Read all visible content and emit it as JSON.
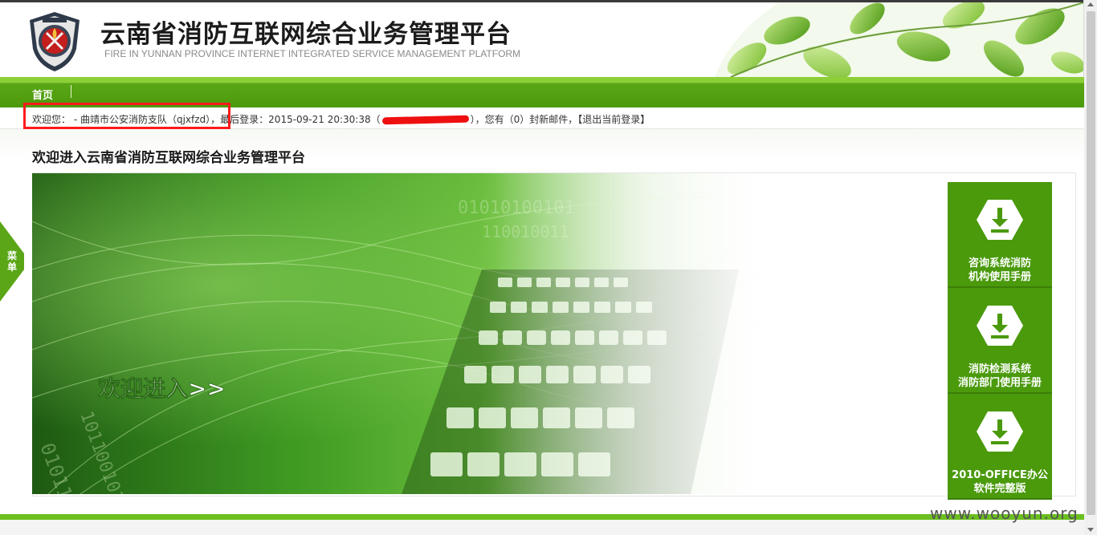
{
  "header": {
    "title_cn": "云南省消防互联网综合业务管理平台",
    "title_en": "FIRE IN YUNNAN PROVINCE INTERNET INTEGRATED SERVICE MANAGEMENT PLATFORM",
    "logo_icon": "fire-police-badge-icon"
  },
  "nav": {
    "items": [
      {
        "label": "首页"
      }
    ]
  },
  "info_bar": {
    "welcome_prefix": "欢迎您： - 曲靖市公安消防支队（qjxfzd），",
    "last_login_label": "最后登录：",
    "last_login_time": "2015-09-21 20:30:38",
    "open_paren": "（",
    "close_paren": "），",
    "mail_text": "您有（0）封新邮件，",
    "logout_label": "【退出当前登录】"
  },
  "main": {
    "section_title": "欢迎进入云南省消防互联网综合业务管理平台",
    "banner_text": "欢迎进入>>"
  },
  "side_tab": {
    "label": "菜单"
  },
  "downloads": [
    {
      "label": "咨询系统消防\n机构使用手册",
      "icon": "download-icon"
    },
    {
      "label": "消防检测系统\n消防部门使用手册",
      "icon": "download-icon"
    },
    {
      "label": "2010-OFFICE办公\n软件完整版",
      "icon": "download-icon"
    }
  ],
  "watermark": "www.wooyun.org",
  "colors": {
    "brand_green": "#4a9a0c",
    "nav_green": "#5aa616",
    "highlight_red": "#ff1a1a"
  }
}
